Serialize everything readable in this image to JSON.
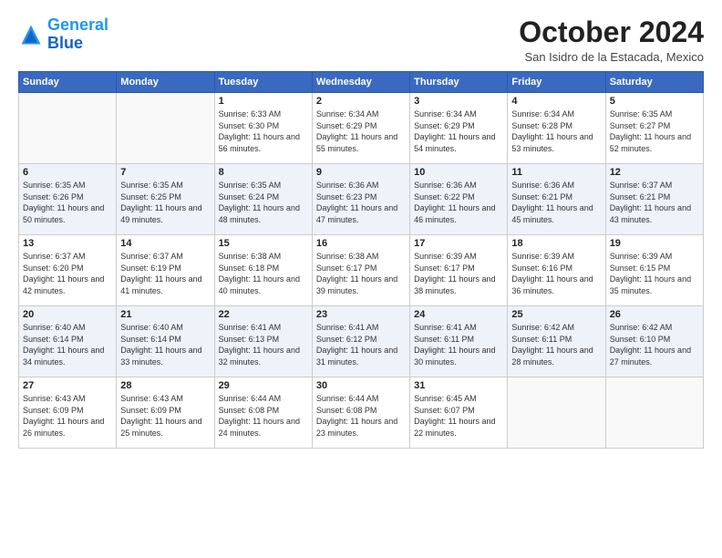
{
  "logo": {
    "line1": "General",
    "line2": "Blue"
  },
  "title": "October 2024",
  "location": "San Isidro de la Estacada, Mexico",
  "weekdays": [
    "Sunday",
    "Monday",
    "Tuesday",
    "Wednesday",
    "Thursday",
    "Friday",
    "Saturday"
  ],
  "days": [
    {
      "date": "",
      "info": ""
    },
    {
      "date": "",
      "info": ""
    },
    {
      "date": "1",
      "info": "Sunrise: 6:33 AM\nSunset: 6:30 PM\nDaylight: 11 hours and 56 minutes."
    },
    {
      "date": "2",
      "info": "Sunrise: 6:34 AM\nSunset: 6:29 PM\nDaylight: 11 hours and 55 minutes."
    },
    {
      "date": "3",
      "info": "Sunrise: 6:34 AM\nSunset: 6:29 PM\nDaylight: 11 hours and 54 minutes."
    },
    {
      "date": "4",
      "info": "Sunrise: 6:34 AM\nSunset: 6:28 PM\nDaylight: 11 hours and 53 minutes."
    },
    {
      "date": "5",
      "info": "Sunrise: 6:35 AM\nSunset: 6:27 PM\nDaylight: 11 hours and 52 minutes."
    },
    {
      "date": "6",
      "info": "Sunrise: 6:35 AM\nSunset: 6:26 PM\nDaylight: 11 hours and 50 minutes."
    },
    {
      "date": "7",
      "info": "Sunrise: 6:35 AM\nSunset: 6:25 PM\nDaylight: 11 hours and 49 minutes."
    },
    {
      "date": "8",
      "info": "Sunrise: 6:35 AM\nSunset: 6:24 PM\nDaylight: 11 hours and 48 minutes."
    },
    {
      "date": "9",
      "info": "Sunrise: 6:36 AM\nSunset: 6:23 PM\nDaylight: 11 hours and 47 minutes."
    },
    {
      "date": "10",
      "info": "Sunrise: 6:36 AM\nSunset: 6:22 PM\nDaylight: 11 hours and 46 minutes."
    },
    {
      "date": "11",
      "info": "Sunrise: 6:36 AM\nSunset: 6:21 PM\nDaylight: 11 hours and 45 minutes."
    },
    {
      "date": "12",
      "info": "Sunrise: 6:37 AM\nSunset: 6:21 PM\nDaylight: 11 hours and 43 minutes."
    },
    {
      "date": "13",
      "info": "Sunrise: 6:37 AM\nSunset: 6:20 PM\nDaylight: 11 hours and 42 minutes."
    },
    {
      "date": "14",
      "info": "Sunrise: 6:37 AM\nSunset: 6:19 PM\nDaylight: 11 hours and 41 minutes."
    },
    {
      "date": "15",
      "info": "Sunrise: 6:38 AM\nSunset: 6:18 PM\nDaylight: 11 hours and 40 minutes."
    },
    {
      "date": "16",
      "info": "Sunrise: 6:38 AM\nSunset: 6:17 PM\nDaylight: 11 hours and 39 minutes."
    },
    {
      "date": "17",
      "info": "Sunrise: 6:39 AM\nSunset: 6:17 PM\nDaylight: 11 hours and 38 minutes."
    },
    {
      "date": "18",
      "info": "Sunrise: 6:39 AM\nSunset: 6:16 PM\nDaylight: 11 hours and 36 minutes."
    },
    {
      "date": "19",
      "info": "Sunrise: 6:39 AM\nSunset: 6:15 PM\nDaylight: 11 hours and 35 minutes."
    },
    {
      "date": "20",
      "info": "Sunrise: 6:40 AM\nSunset: 6:14 PM\nDaylight: 11 hours and 34 minutes."
    },
    {
      "date": "21",
      "info": "Sunrise: 6:40 AM\nSunset: 6:14 PM\nDaylight: 11 hours and 33 minutes."
    },
    {
      "date": "22",
      "info": "Sunrise: 6:41 AM\nSunset: 6:13 PM\nDaylight: 11 hours and 32 minutes."
    },
    {
      "date": "23",
      "info": "Sunrise: 6:41 AM\nSunset: 6:12 PM\nDaylight: 11 hours and 31 minutes."
    },
    {
      "date": "24",
      "info": "Sunrise: 6:41 AM\nSunset: 6:11 PM\nDaylight: 11 hours and 30 minutes."
    },
    {
      "date": "25",
      "info": "Sunrise: 6:42 AM\nSunset: 6:11 PM\nDaylight: 11 hours and 28 minutes."
    },
    {
      "date": "26",
      "info": "Sunrise: 6:42 AM\nSunset: 6:10 PM\nDaylight: 11 hours and 27 minutes."
    },
    {
      "date": "27",
      "info": "Sunrise: 6:43 AM\nSunset: 6:09 PM\nDaylight: 11 hours and 26 minutes."
    },
    {
      "date": "28",
      "info": "Sunrise: 6:43 AM\nSunset: 6:09 PM\nDaylight: 11 hours and 25 minutes."
    },
    {
      "date": "29",
      "info": "Sunrise: 6:44 AM\nSunset: 6:08 PM\nDaylight: 11 hours and 24 minutes."
    },
    {
      "date": "30",
      "info": "Sunrise: 6:44 AM\nSunset: 6:08 PM\nDaylight: 11 hours and 23 minutes."
    },
    {
      "date": "31",
      "info": "Sunrise: 6:45 AM\nSunset: 6:07 PM\nDaylight: 11 hours and 22 minutes."
    },
    {
      "date": "",
      "info": ""
    },
    {
      "date": "",
      "info": ""
    },
    {
      "date": "",
      "info": ""
    },
    {
      "date": "",
      "info": ""
    }
  ]
}
